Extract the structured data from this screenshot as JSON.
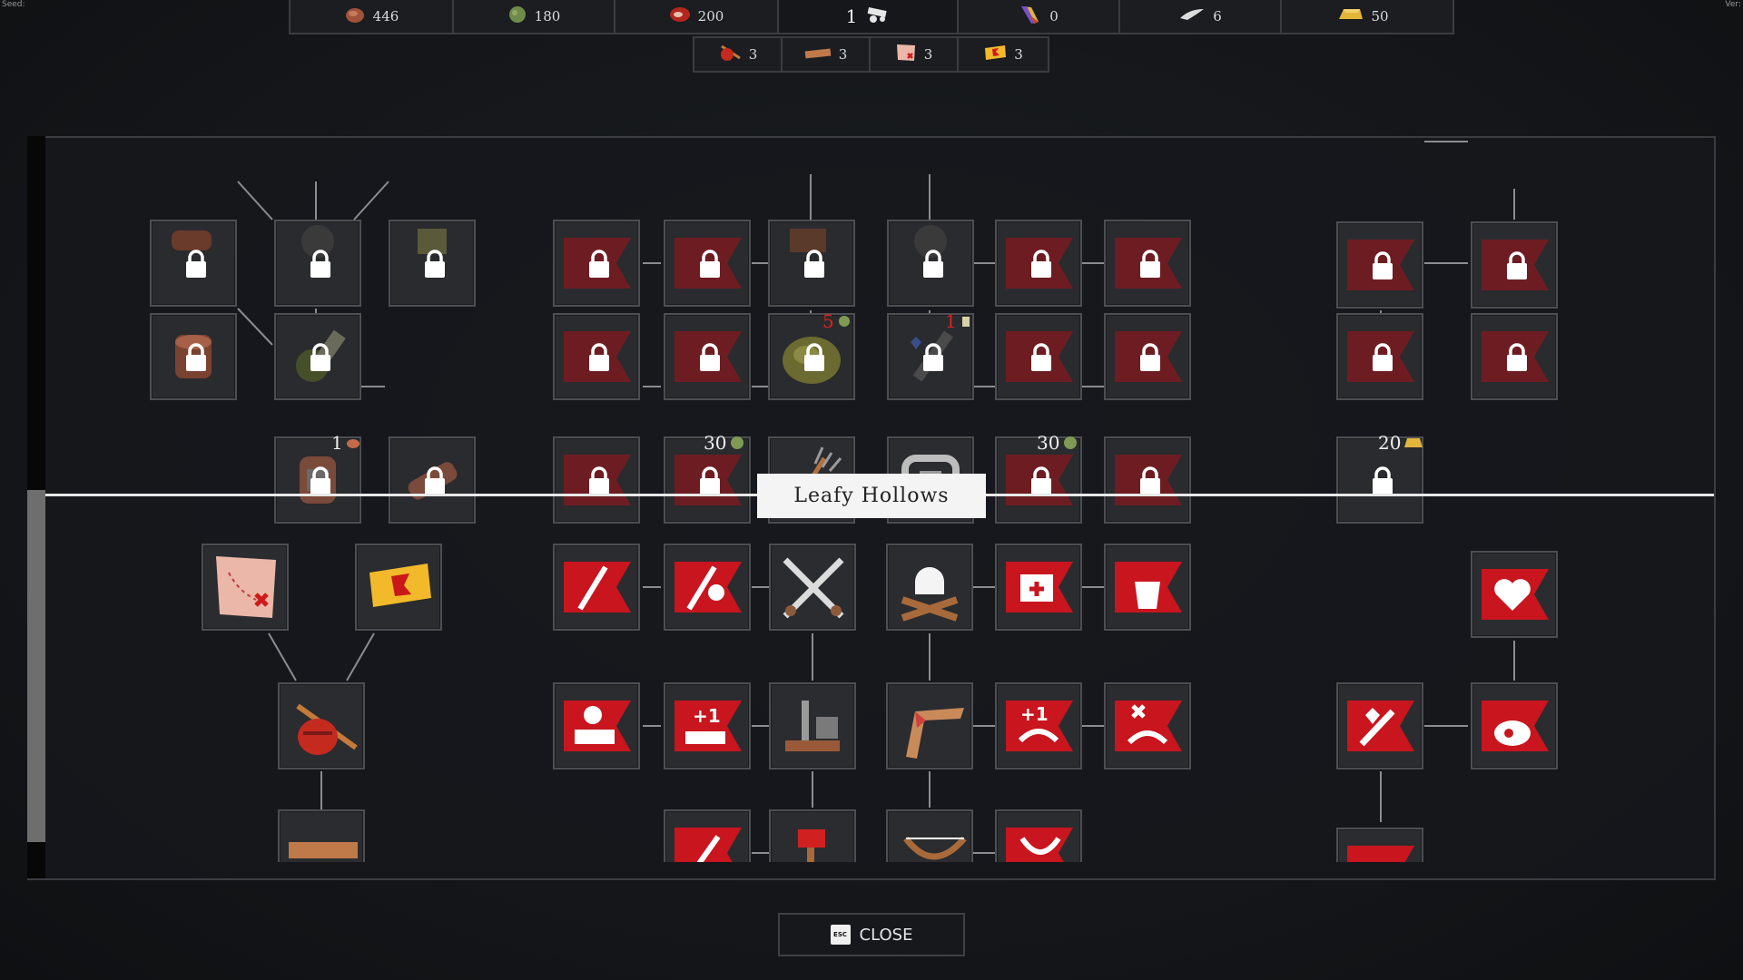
{
  "corner": {
    "seed_label": "Seed:",
    "ver_label": "Ver:"
  },
  "resources_top": [
    {
      "icon": "meat-icon",
      "value": "446"
    },
    {
      "icon": "plant-fiber-icon",
      "value": "180"
    },
    {
      "icon": "raw-steak-icon",
      "value": "200"
    },
    {
      "icon": "cannon-icon",
      "value": "1"
    },
    {
      "icon": "feather-horn-icon",
      "value": "0"
    },
    {
      "icon": "tooth-icon",
      "value": "6"
    },
    {
      "icon": "gold-bar-icon",
      "value": "50"
    }
  ],
  "resources_bottom": [
    {
      "icon": "bindle-icon",
      "value": "3"
    },
    {
      "icon": "plank-icon",
      "value": "3"
    },
    {
      "icon": "treasure-map-icon",
      "value": "3"
    },
    {
      "icon": "ticket-icon",
      "value": "3"
    }
  ],
  "costs": {
    "c1": "1",
    "c2": "5",
    "c3": "1",
    "c4": "30",
    "c5": "30",
    "c6": "20"
  },
  "region_label": "Leafy Hollows",
  "close": {
    "key": "ESC",
    "label": "CLOSE"
  },
  "colors": {
    "unlocked_red": "#c8151e",
    "locked_red": "#6d1d22",
    "frame": "#4c4e52",
    "background": "#15171b"
  }
}
